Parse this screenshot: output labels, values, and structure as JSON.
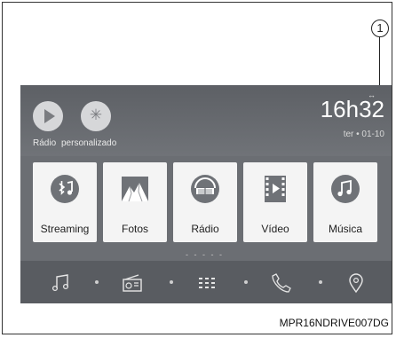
{
  "callout": {
    "number": "1"
  },
  "shortcuts": [
    {
      "label": "Rádio",
      "icon": "play-icon"
    },
    {
      "label": "personalizado",
      "icon": "magic-wand-icon"
    }
  ],
  "status": {
    "sync_icon": "sync-arrows-icon",
    "time": "16h32",
    "date": "ter • 01-10"
  },
  "tiles": [
    {
      "label": "Streaming",
      "icon": "bluetooth-music-icon"
    },
    {
      "label": "Fotos",
      "icon": "photo-mountain-icon"
    },
    {
      "label": "Rádio",
      "icon": "radio-dial-icon"
    },
    {
      "label": "Vídeo",
      "icon": "video-film-icon"
    },
    {
      "label": "Música",
      "icon": "music-note-icon"
    }
  ],
  "page_dots": "- - - - -",
  "bottom_bar": [
    "music-icon",
    "radio-icon",
    "apps-grid-icon",
    "phone-icon",
    "location-pin-icon"
  ],
  "colors": {
    "screen_bg": "#6b6e73",
    "tile_bg": "#f4f4f4",
    "tile_icon": "#6f7277"
  },
  "caption": "MPR16NDRIVE007DG"
}
